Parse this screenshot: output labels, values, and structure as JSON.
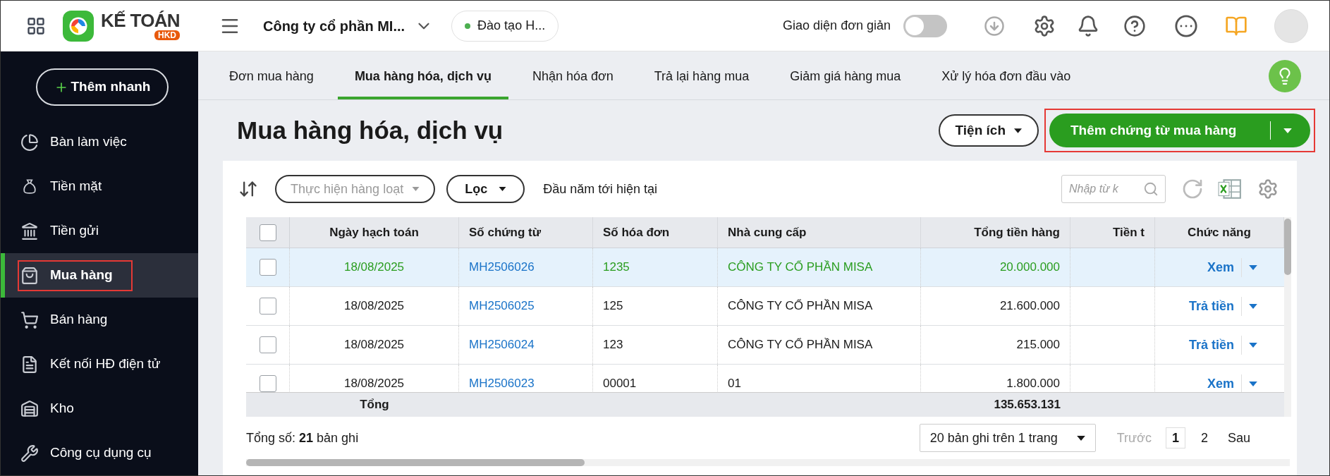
{
  "topbar": {
    "brand": {
      "name": "KẾ TOÁN",
      "badge": "HKD"
    },
    "company": "Công ty cổ phần MI...",
    "branch": {
      "label": "Đào tạo H...",
      "color": "#4caf50"
    },
    "simple_mode": {
      "label": "Giao diện đơn giản",
      "on": false
    }
  },
  "sidebar": {
    "quick_add": "Thêm nhanh",
    "items": [
      {
        "label": "Bàn làm việc",
        "selected": false,
        "highlighted": false
      },
      {
        "label": "Tiền mặt",
        "selected": false,
        "highlighted": false
      },
      {
        "label": "Tiền gửi",
        "selected": false,
        "highlighted": false
      },
      {
        "label": "Mua hàng",
        "selected": true,
        "highlighted": true
      },
      {
        "label": "Bán hàng",
        "selected": false,
        "highlighted": false
      },
      {
        "label": "Kết nối HĐ điện tử",
        "selected": false,
        "highlighted": false
      },
      {
        "label": "Kho",
        "selected": false,
        "highlighted": false
      },
      {
        "label": "Công cụ dụng cụ",
        "selected": false,
        "highlighted": false
      }
    ]
  },
  "tabs": [
    {
      "label": "Đơn mua hàng",
      "selected": false
    },
    {
      "label": "Mua hàng hóa, dịch vụ",
      "selected": true
    },
    {
      "label": "Nhận hóa đơn",
      "selected": false
    },
    {
      "label": "Trả lại hàng mua",
      "selected": false
    },
    {
      "label": "Giảm giá hàng mua",
      "selected": false
    },
    {
      "label": "Xử lý hóa đơn đầu vào",
      "selected": false
    }
  ],
  "page": {
    "title": "Mua hàng hóa, dịch vụ",
    "utilities_button": "Tiện ích",
    "add_button": {
      "label": "Thêm chứng từ mua hàng",
      "highlighted": true
    }
  },
  "toolbar": {
    "bulk_action": {
      "label": "Thực hiện hàng loạt",
      "disabled": true
    },
    "filter": "Lọc",
    "period": "Đầu năm tới hiện tại",
    "search": {
      "placeholder": "Nhập từ k"
    }
  },
  "table": {
    "header_checked": false,
    "columns": [
      "Ngày hạch toán",
      "Số chứng từ",
      "Số hóa đơn",
      "Nhà cung cấp",
      "Tổng tiền hàng",
      "Tiền t",
      "Chức năng"
    ],
    "rows": [
      {
        "selected": true,
        "checked": false,
        "date": "18/08/2025",
        "voucher": "MH2506026",
        "invoice": "1235",
        "supplier": "CÔNG TY CỔ PHẦN MISA",
        "total": "20.000.000",
        "action": "Xem"
      },
      {
        "selected": false,
        "checked": false,
        "date": "18/08/2025",
        "voucher": "MH2506025",
        "invoice": "125",
        "supplier": "CÔNG TY CỔ PHẦN MISA",
        "total": "21.600.000",
        "action": "Trả tiền"
      },
      {
        "selected": false,
        "checked": false,
        "date": "18/08/2025",
        "voucher": "MH2506024",
        "invoice": "123",
        "supplier": "CÔNG TY CỔ PHẦN MISA",
        "total": "215.000",
        "action": "Trả tiền"
      },
      {
        "selected": false,
        "checked": false,
        "date": "18/08/2025",
        "voucher": "MH2506023",
        "invoice": "00001",
        "supplier": "01",
        "total": "1.800.000",
        "action": "Xem"
      }
    ],
    "totals": {
      "label": "Tổng",
      "total": "135.653.131"
    }
  },
  "footer": {
    "record_count": "Tổng số: **21** bản ghi",
    "page_size": "20 bản ghi trên 1 trang",
    "pages": [
      {
        "label": "Trước",
        "kind": "prev",
        "disabled": true,
        "selected": false
      },
      {
        "label": "1",
        "kind": "page",
        "disabled": false,
        "selected": true
      },
      {
        "label": "2",
        "kind": "page",
        "disabled": false,
        "selected": false
      },
      {
        "label": "Sau",
        "kind": "next",
        "disabled": false,
        "selected": false
      }
    ]
  }
}
